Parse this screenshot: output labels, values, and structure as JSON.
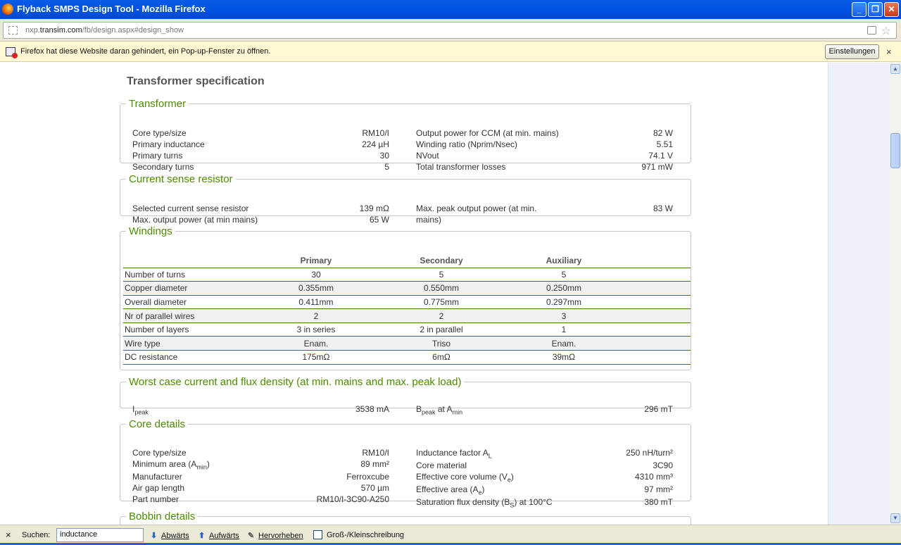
{
  "window": {
    "title": "Flyback SMPS Design Tool - Mozilla Firefox"
  },
  "address": {
    "url_prefix": "nxp.",
    "url_domain": "transim.com",
    "url_path": "/fb/design.aspx#design_show"
  },
  "notification": {
    "message": "Firefox hat diese Website daran gehindert, ein Pop-up-Fenster zu öffnen.",
    "settings_label": "Einstellungen",
    "close_label": "×"
  },
  "page": {
    "title": "Transformer specification"
  },
  "transformer": {
    "legend": "Transformer",
    "left": [
      {
        "label": "Core type/size",
        "value": "RM10/I"
      },
      {
        "label": "Primary inductance",
        "value": "224 µH"
      },
      {
        "label": "Primary turns",
        "value": "30"
      },
      {
        "label": "Secondary turns",
        "value": "5"
      }
    ],
    "right": [
      {
        "label": "Output power for CCM (at min. mains)",
        "value": "82 W"
      },
      {
        "label": "Winding ratio (Nprim/Nsec)",
        "value": "5.51"
      },
      {
        "label": "NVout",
        "value": "74.1 V"
      },
      {
        "label": "Total transformer losses",
        "value": "971 mW"
      }
    ]
  },
  "current_sense": {
    "legend": "Current sense resistor",
    "left": [
      {
        "label": "Selected current sense resistor",
        "value": "139 mΩ"
      },
      {
        "label": "Max. output power (at min mains)",
        "value": "65 W"
      }
    ],
    "right_label_1": "Max. peak output power (at min.",
    "right_label_2": "mains)",
    "right_value": "83 W"
  },
  "windings": {
    "legend": "Windings",
    "headers": [
      "",
      "Primary",
      "Secondary",
      "Auxiliary"
    ],
    "rows": [
      [
        "Number of turns",
        "30",
        "5",
        "5"
      ],
      [
        "Copper diameter",
        "0.355mm",
        "0.550mm",
        "0.250mm"
      ],
      [
        "Overall diameter",
        "0.411mm",
        "0.775mm",
        "0.297mm"
      ],
      [
        "Nr of parallel wires",
        "2",
        "2",
        "3"
      ],
      [
        "Number of layers",
        "3 in series",
        "2 in parallel",
        "1"
      ],
      [
        "Wire type",
        "Enam.",
        "Triso",
        "Enam."
      ],
      [
        "DC resistance",
        "175mΩ",
        "6mΩ",
        "39mΩ"
      ]
    ]
  },
  "worst_case": {
    "legend": "Worst case current and flux density (at min. mains and max. peak load)",
    "ipeak_main": "I",
    "ipeak_sub": "peak",
    "ipeak_value": "3538 mA",
    "bpeak_main": "B",
    "bpeak_sub": "peak",
    "bpeak_mid": " at A",
    "bpeak_sub2": "min",
    "bpeak_value": "296 mT"
  },
  "core": {
    "legend": "Core details",
    "left": [
      {
        "label": "Core type/size",
        "value": "RM10/I"
      },
      {
        "label": "Minimum area (A",
        "sub": "min",
        "tail": ")",
        "value": "89 mm²"
      },
      {
        "label": "Manufacturer",
        "value": "Ferroxcube"
      },
      {
        "label": "Air gap length",
        "value": "570 µm"
      },
      {
        "label": "Part number",
        "value": "RM10/I-3C90-A250"
      }
    ],
    "right": [
      {
        "label": "Inductance factor A",
        "sub": "L",
        "tail": "",
        "value": "250 nH/turn²"
      },
      {
        "label": "Core material",
        "value": "3C90"
      },
      {
        "label": "Effective core volume (V",
        "sub": "e",
        "tail": ")",
        "value": "4310 mm³"
      },
      {
        "label": "Effective area (A",
        "sub": "e",
        "tail": ")",
        "value": "97 mm²"
      },
      {
        "label": "Saturation flux density (B",
        "sub": "S",
        "tail": ") at 100°C",
        "value": "380 mT"
      }
    ]
  },
  "bobbin": {
    "legend": "Bobbin details"
  },
  "findbar": {
    "close_label": "×",
    "label": "Suchen:",
    "value": "inductance",
    "down_label": "Abwärts",
    "up_label": "Aufwärts",
    "highlight_label": "Hervorheben",
    "case_label": "Groß-/Kleinschreibung"
  }
}
